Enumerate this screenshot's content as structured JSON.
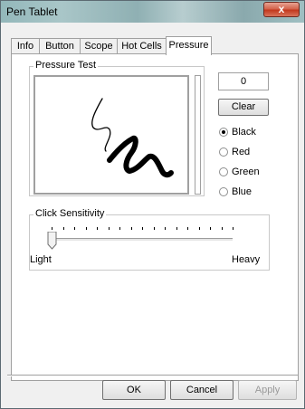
{
  "window": {
    "title": "Pen Tablet",
    "close_glyph": "x"
  },
  "tabs": [
    {
      "label": "Info"
    },
    {
      "label": "Button"
    },
    {
      "label": "Scope"
    },
    {
      "label": "Hot Cells"
    },
    {
      "label": "Pressure"
    }
  ],
  "active_tab": "Pressure",
  "pressure_test": {
    "label": "Pressure Test",
    "counter_value": "0",
    "clear_label": "Clear",
    "colors": [
      {
        "label": "Black",
        "selected": true
      },
      {
        "label": "Red",
        "selected": false
      },
      {
        "label": "Green",
        "selected": false
      },
      {
        "label": "Blue",
        "selected": false
      }
    ]
  },
  "click_sensitivity": {
    "label": "Click Sensitivity",
    "min_label": "Light",
    "max_label": "Heavy",
    "tick_count": 17,
    "value_fraction": 0.0
  },
  "footer": {
    "ok_label": "OK",
    "cancel_label": "Cancel",
    "apply_label": "Apply"
  }
}
